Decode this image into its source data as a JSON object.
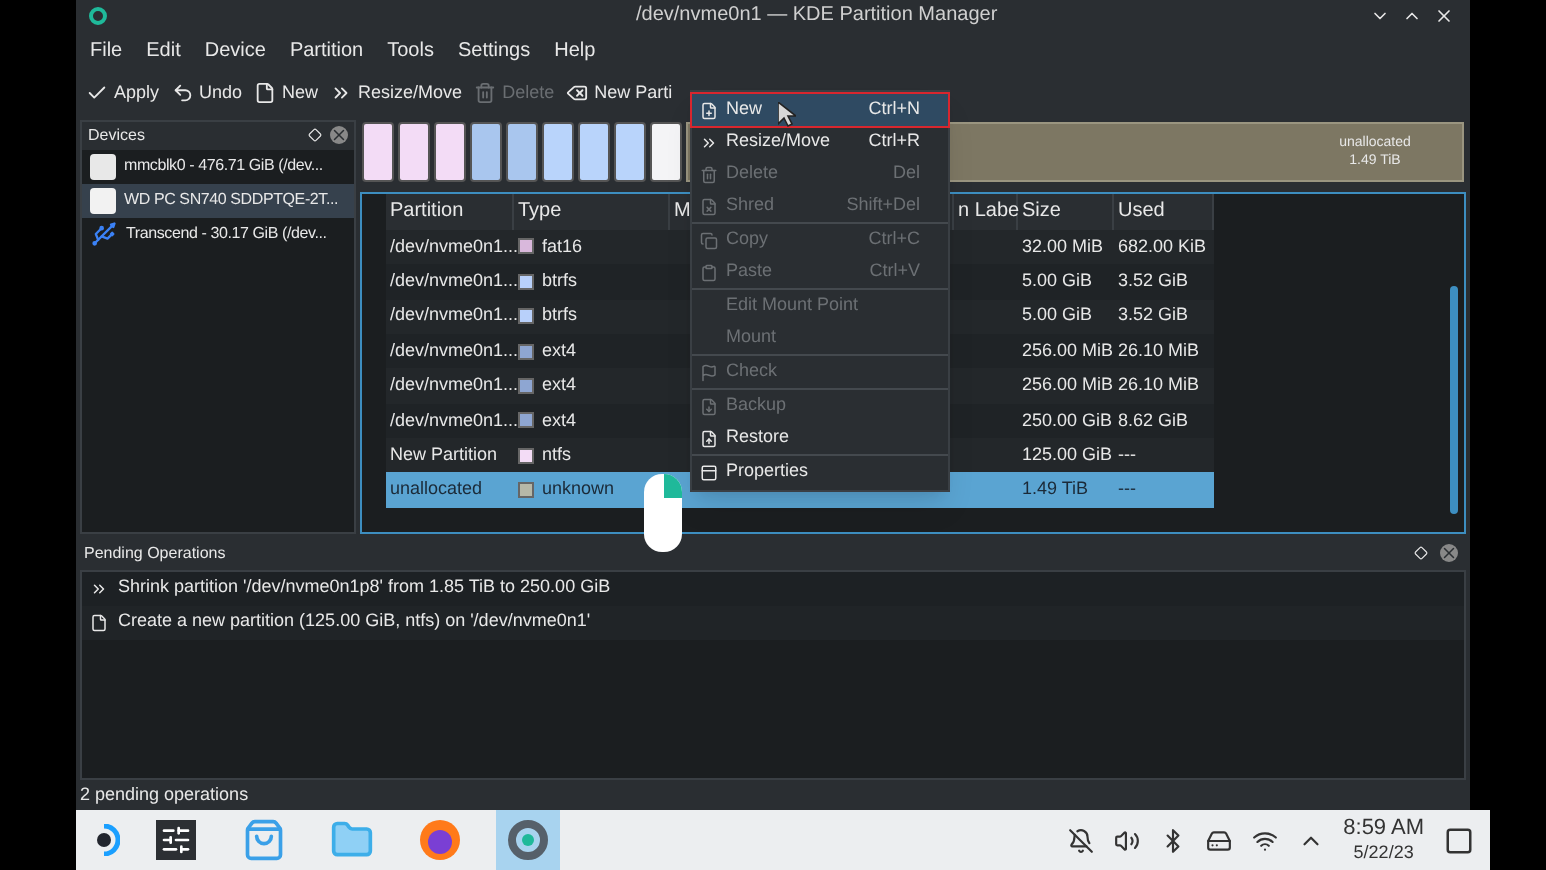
{
  "window": {
    "title": "/dev/nvme0n1 — KDE Partition Manager"
  },
  "menu_bar": [
    "File",
    "Edit",
    "Device",
    "Partition",
    "Tools",
    "Settings",
    "Help"
  ],
  "toolbar": [
    {
      "label": "Apply",
      "disabled": false
    },
    {
      "label": "Undo",
      "disabled": false
    },
    {
      "label": "New",
      "disabled": false
    },
    {
      "label": "Resize/Move",
      "disabled": false
    },
    {
      "label": "Delete",
      "disabled": true
    },
    {
      "label": "New Parti",
      "disabled": false
    }
  ],
  "devices": {
    "title": "Devices",
    "items": [
      {
        "kind": "sd",
        "label": "mmcblk0 - 476.71 GiB (/dev...",
        "selected": false
      },
      {
        "kind": "disk",
        "label": "WD PC SN740 SDDPTQE-2T...",
        "selected": true
      },
      {
        "kind": "usb",
        "label": "Transcend - 30.17 GiB (/dev...",
        "selected": false
      }
    ]
  },
  "disk_map": {
    "segments": [
      {
        "color": "#f3dcf6"
      },
      {
        "color": "#f3dcf6"
      },
      {
        "color": "#f3dcf6"
      },
      {
        "color": "#a9c6ee"
      },
      {
        "color": "#a9c6ee"
      },
      {
        "color": "#b9d4fb"
      },
      {
        "color": "#b9d4fb"
      },
      {
        "color": "#b9d4fb"
      },
      {
        "color": "#f4f4f6"
      }
    ],
    "unallocated": {
      "label": "unallocated",
      "size": "1.49 TiB"
    }
  },
  "table": {
    "columns": [
      "Partition",
      "Type",
      "M",
      "n Labe",
      "Size",
      "Used"
    ],
    "rows": [
      {
        "partition": "/dev/nvme0n1...",
        "type": "fat16",
        "color": "#d9b8dc",
        "size": "32.00 MiB",
        "used": "682.00 KiB",
        "selected": false
      },
      {
        "partition": "/dev/nvme0n1...",
        "type": "btrfs",
        "color": "#b8d0fa",
        "size": "5.00 GiB",
        "used": "3.52 GiB",
        "selected": false
      },
      {
        "partition": "/dev/nvme0n1...",
        "type": "btrfs",
        "color": "#b8d0fa",
        "size": "5.00 GiB",
        "used": "3.52 GiB",
        "selected": false
      },
      {
        "partition": "/dev/nvme0n1...",
        "type": "ext4",
        "color": "#8ea6d2",
        "size": "256.00 MiB",
        "used": "26.10 MiB",
        "selected": false
      },
      {
        "partition": "/dev/nvme0n1...",
        "type": "ext4",
        "color": "#8ea6d2",
        "size": "256.00 MiB",
        "used": "26.10 MiB",
        "selected": false
      },
      {
        "partition": "/dev/nvme0n1...",
        "type": "ext4",
        "color": "#8ea6d2",
        "size": "250.00 GiB",
        "used": "8.62 GiB",
        "selected": false
      },
      {
        "partition": "New Partition",
        "type": "ntfs",
        "color": "#f3dcf6",
        "size": "125.00 GiB",
        "used": "---",
        "selected": false
      },
      {
        "partition": "unallocated",
        "type": "unknown",
        "color": "#b6b8a8",
        "size": "1.49 TiB",
        "used": "---",
        "selected": true
      }
    ]
  },
  "context_menu": [
    {
      "kind": "item",
      "label": "New",
      "shortcut": "Ctrl+N",
      "disabled": false,
      "selected": true
    },
    {
      "kind": "item",
      "label": "Resize/Move",
      "shortcut": "Ctrl+R",
      "disabled": false,
      "selected": false
    },
    {
      "kind": "item",
      "label": "Delete",
      "shortcut": "Del",
      "disabled": true,
      "selected": false
    },
    {
      "kind": "item",
      "label": "Shred",
      "shortcut": "Shift+Del",
      "disabled": true,
      "selected": false
    },
    {
      "kind": "separator"
    },
    {
      "kind": "item",
      "label": "Copy",
      "shortcut": "Ctrl+C",
      "disabled": true,
      "selected": false
    },
    {
      "kind": "item",
      "label": "Paste",
      "shortcut": "Ctrl+V",
      "disabled": true,
      "selected": false
    },
    {
      "kind": "separator"
    },
    {
      "kind": "item",
      "label": "Edit Mount Point",
      "disabled": true,
      "selected": false
    },
    {
      "kind": "item",
      "label": "Mount",
      "disabled": true,
      "selected": false
    },
    {
      "kind": "separator"
    },
    {
      "kind": "item",
      "label": "Check",
      "disabled": true,
      "selected": false
    },
    {
      "kind": "separator"
    },
    {
      "kind": "item",
      "label": "Backup",
      "disabled": true,
      "selected": false
    },
    {
      "kind": "item",
      "label": "Restore",
      "disabled": false,
      "selected": false
    },
    {
      "kind": "separator"
    },
    {
      "kind": "item",
      "label": "Properties",
      "disabled": false,
      "selected": false
    }
  ],
  "pending_operations": {
    "title": "Pending Operations",
    "items": [
      {
        "kind": "resize",
        "text": "Shrink partition '/dev/nvme0n1p8' from 1.85 TiB to 250.00 GiB"
      },
      {
        "kind": "new",
        "text": "Create a new partition (125.00 GiB, ntfs) on '/dev/nvme0n1'"
      }
    ]
  },
  "status_bar": "2 pending operations",
  "taskbar": {
    "apps": [
      {
        "selected": false
      },
      {
        "selected": false
      },
      {
        "selected": false
      },
      {
        "selected": false
      },
      {
        "selected": true
      }
    ],
    "time": "8:59 AM",
    "date": "5/22/23"
  }
}
